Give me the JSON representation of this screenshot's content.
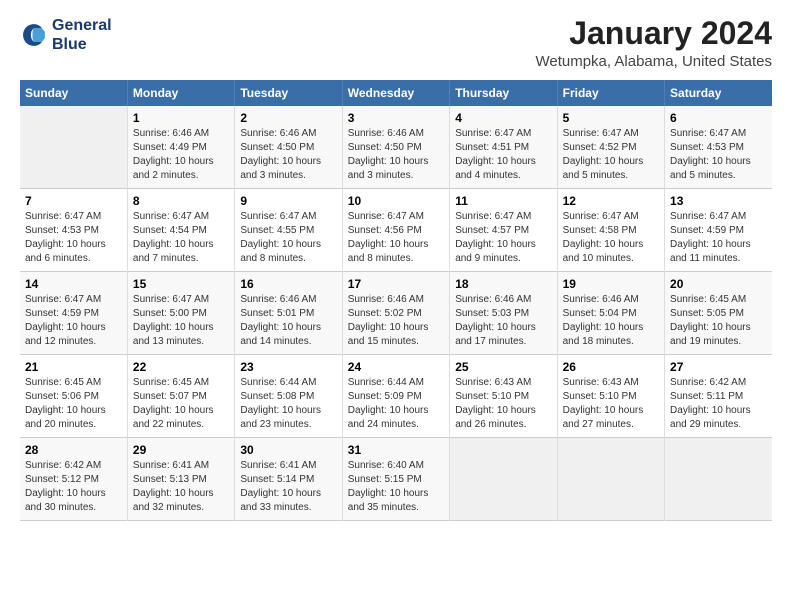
{
  "header": {
    "logo_line1": "General",
    "logo_line2": "Blue",
    "title": "January 2024",
    "subtitle": "Wetumpka, Alabama, United States"
  },
  "days_of_week": [
    "Sunday",
    "Monday",
    "Tuesday",
    "Wednesday",
    "Thursday",
    "Friday",
    "Saturday"
  ],
  "weeks": [
    [
      {
        "num": "",
        "info": ""
      },
      {
        "num": "1",
        "info": "Sunrise: 6:46 AM\nSunset: 4:49 PM\nDaylight: 10 hours\nand 2 minutes."
      },
      {
        "num": "2",
        "info": "Sunrise: 6:46 AM\nSunset: 4:50 PM\nDaylight: 10 hours\nand 3 minutes."
      },
      {
        "num": "3",
        "info": "Sunrise: 6:46 AM\nSunset: 4:50 PM\nDaylight: 10 hours\nand 3 minutes."
      },
      {
        "num": "4",
        "info": "Sunrise: 6:47 AM\nSunset: 4:51 PM\nDaylight: 10 hours\nand 4 minutes."
      },
      {
        "num": "5",
        "info": "Sunrise: 6:47 AM\nSunset: 4:52 PM\nDaylight: 10 hours\nand 5 minutes."
      },
      {
        "num": "6",
        "info": "Sunrise: 6:47 AM\nSunset: 4:53 PM\nDaylight: 10 hours\nand 5 minutes."
      }
    ],
    [
      {
        "num": "7",
        "info": "Sunrise: 6:47 AM\nSunset: 4:53 PM\nDaylight: 10 hours\nand 6 minutes."
      },
      {
        "num": "8",
        "info": "Sunrise: 6:47 AM\nSunset: 4:54 PM\nDaylight: 10 hours\nand 7 minutes."
      },
      {
        "num": "9",
        "info": "Sunrise: 6:47 AM\nSunset: 4:55 PM\nDaylight: 10 hours\nand 8 minutes."
      },
      {
        "num": "10",
        "info": "Sunrise: 6:47 AM\nSunset: 4:56 PM\nDaylight: 10 hours\nand 8 minutes."
      },
      {
        "num": "11",
        "info": "Sunrise: 6:47 AM\nSunset: 4:57 PM\nDaylight: 10 hours\nand 9 minutes."
      },
      {
        "num": "12",
        "info": "Sunrise: 6:47 AM\nSunset: 4:58 PM\nDaylight: 10 hours\nand 10 minutes."
      },
      {
        "num": "13",
        "info": "Sunrise: 6:47 AM\nSunset: 4:59 PM\nDaylight: 10 hours\nand 11 minutes."
      }
    ],
    [
      {
        "num": "14",
        "info": "Sunrise: 6:47 AM\nSunset: 4:59 PM\nDaylight: 10 hours\nand 12 minutes."
      },
      {
        "num": "15",
        "info": "Sunrise: 6:47 AM\nSunset: 5:00 PM\nDaylight: 10 hours\nand 13 minutes."
      },
      {
        "num": "16",
        "info": "Sunrise: 6:46 AM\nSunset: 5:01 PM\nDaylight: 10 hours\nand 14 minutes."
      },
      {
        "num": "17",
        "info": "Sunrise: 6:46 AM\nSunset: 5:02 PM\nDaylight: 10 hours\nand 15 minutes."
      },
      {
        "num": "18",
        "info": "Sunrise: 6:46 AM\nSunset: 5:03 PM\nDaylight: 10 hours\nand 17 minutes."
      },
      {
        "num": "19",
        "info": "Sunrise: 6:46 AM\nSunset: 5:04 PM\nDaylight: 10 hours\nand 18 minutes."
      },
      {
        "num": "20",
        "info": "Sunrise: 6:45 AM\nSunset: 5:05 PM\nDaylight: 10 hours\nand 19 minutes."
      }
    ],
    [
      {
        "num": "21",
        "info": "Sunrise: 6:45 AM\nSunset: 5:06 PM\nDaylight: 10 hours\nand 20 minutes."
      },
      {
        "num": "22",
        "info": "Sunrise: 6:45 AM\nSunset: 5:07 PM\nDaylight: 10 hours\nand 22 minutes."
      },
      {
        "num": "23",
        "info": "Sunrise: 6:44 AM\nSunset: 5:08 PM\nDaylight: 10 hours\nand 23 minutes."
      },
      {
        "num": "24",
        "info": "Sunrise: 6:44 AM\nSunset: 5:09 PM\nDaylight: 10 hours\nand 24 minutes."
      },
      {
        "num": "25",
        "info": "Sunrise: 6:43 AM\nSunset: 5:10 PM\nDaylight: 10 hours\nand 26 minutes."
      },
      {
        "num": "26",
        "info": "Sunrise: 6:43 AM\nSunset: 5:10 PM\nDaylight: 10 hours\nand 27 minutes."
      },
      {
        "num": "27",
        "info": "Sunrise: 6:42 AM\nSunset: 5:11 PM\nDaylight: 10 hours\nand 29 minutes."
      }
    ],
    [
      {
        "num": "28",
        "info": "Sunrise: 6:42 AM\nSunset: 5:12 PM\nDaylight: 10 hours\nand 30 minutes."
      },
      {
        "num": "29",
        "info": "Sunrise: 6:41 AM\nSunset: 5:13 PM\nDaylight: 10 hours\nand 32 minutes."
      },
      {
        "num": "30",
        "info": "Sunrise: 6:41 AM\nSunset: 5:14 PM\nDaylight: 10 hours\nand 33 minutes."
      },
      {
        "num": "31",
        "info": "Sunrise: 6:40 AM\nSunset: 5:15 PM\nDaylight: 10 hours\nand 35 minutes."
      },
      {
        "num": "",
        "info": ""
      },
      {
        "num": "",
        "info": ""
      },
      {
        "num": "",
        "info": ""
      }
    ]
  ],
  "colors": {
    "header_bg": "#3a6ea8",
    "accent": "#003366"
  }
}
